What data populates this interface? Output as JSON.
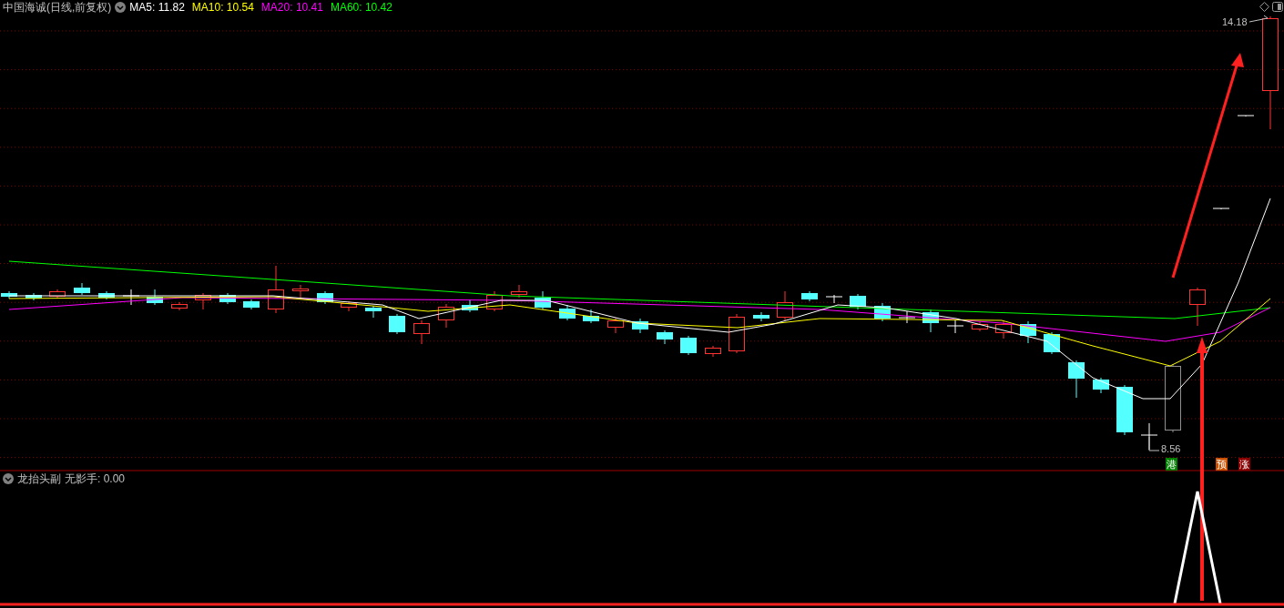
{
  "chart_header": {
    "title": "中国海诚(日线,前复权)",
    "indicators": [
      {
        "label": "MA5: 11.82",
        "color": "#ffffff"
      },
      {
        "label": "MA10: 10.54",
        "color": "#ffff00"
      },
      {
        "label": "MA20: 10.41",
        "color": "#ff00ff"
      },
      {
        "label": "MA60: 10.42",
        "color": "#00ff00"
      }
    ]
  },
  "price_labels": {
    "high": "14.18",
    "low": "8.56"
  },
  "signals": [
    {
      "text": "港",
      "color": "#008000"
    },
    {
      "text": "预",
      "color": "#c85000"
    },
    {
      "text": "涨",
      "color": "#8b0000"
    }
  ],
  "sub_chart": {
    "name": "龙抬头副",
    "value_label": "无影手: 0.00"
  }
}
